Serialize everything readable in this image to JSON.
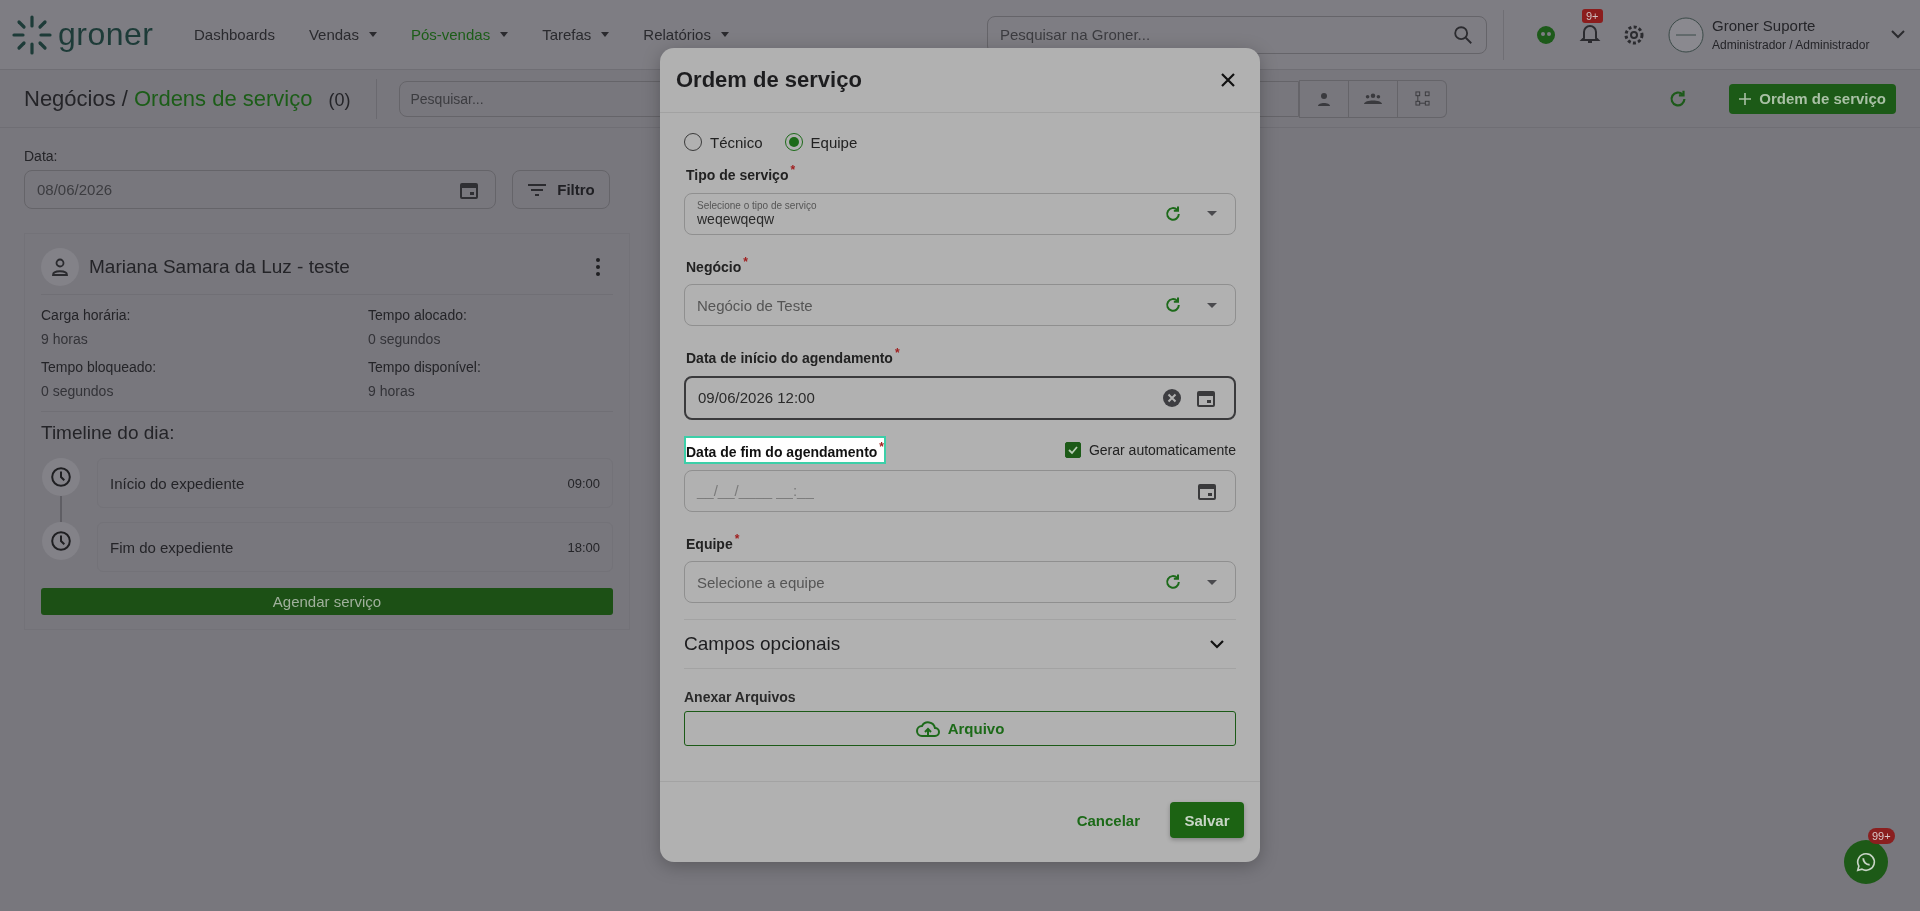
{
  "header": {
    "logo": "groner",
    "nav": [
      {
        "label": "Dashboards",
        "dropdown": false,
        "selected": false
      },
      {
        "label": "Vendas",
        "dropdown": true,
        "selected": false
      },
      {
        "label": "Pós-vendas",
        "dropdown": true,
        "selected": true
      },
      {
        "label": "Tarefas",
        "dropdown": true,
        "selected": false
      },
      {
        "label": "Relatórios",
        "dropdown": true,
        "selected": false
      }
    ],
    "search": {
      "placeholder": "Pesquisar na Groner..."
    },
    "notification_badge": "9+",
    "user": {
      "name": "Groner Suporte",
      "role": "Administrador / Administrador"
    }
  },
  "toolbar": {
    "breadcrumb": "Negócios /",
    "title": "Ordens de serviço",
    "count": "(0)",
    "search": {
      "placeholder": "Pesquisar..."
    },
    "new_button": "Ordem de serviço"
  },
  "filters": {
    "date_label": "Data:",
    "date_value": "08/06/2026",
    "filter_button": "Filtro"
  },
  "technician_card": {
    "name": "Mariana Samara da Luz - teste",
    "stats": [
      {
        "label": "Carga horária:",
        "value": "9 horas"
      },
      {
        "label": "Tempo alocado:",
        "value": "0 segundos"
      },
      {
        "label": "Tempo bloqueado:",
        "value": "0 segundos"
      },
      {
        "label": "Tempo disponível:",
        "value": "9 horas"
      }
    ],
    "timeline_title": "Timeline do dia:",
    "timeline": [
      {
        "label": "Início do expediente",
        "time": "09:00"
      },
      {
        "label": "Fim do expediente",
        "time": "18:00"
      }
    ],
    "schedule_button": "Agendar serviço"
  },
  "modal": {
    "title": "Ordem de serviço",
    "assign_to": [
      {
        "label": "Técnico",
        "selected": false
      },
      {
        "label": "Equipe",
        "selected": true
      }
    ],
    "fields": [
      {
        "kind": "select",
        "label": "Tipo de serviço",
        "required_mark": "*",
        "floating_label": "Selecione o tipo de serviço",
        "value": "weqewqeqw",
        "focused": false,
        "highlighted": false
      },
      {
        "kind": "select",
        "label": "Negócio",
        "required_mark": "*",
        "placeholder": "Negócio de Teste",
        "focused": false,
        "highlighted": false
      },
      {
        "kind": "datetime",
        "label": "Data de início do agendamento",
        "required_mark": "*",
        "value": "09/06/2026 12:00",
        "focused": true,
        "highlighted": false
      },
      {
        "kind": "datetime",
        "label": "Data de fim do agendamento",
        "required_mark": "*",
        "placeholder": "__/__/____ __:__",
        "auto": {
          "label": "Gerar automaticamente",
          "checked": true
        },
        "focused": false,
        "highlighted": true
      },
      {
        "kind": "select",
        "label": "Equipe",
        "required_mark": "*",
        "placeholder": "Selecione a equipe",
        "focused": false,
        "highlighted": false
      }
    ],
    "optional": {
      "title": "Campos opcionais",
      "expanded": false
    },
    "attachments": {
      "label": "Anexar Arquivos",
      "button": "Arquivo"
    },
    "cancel": "Cancelar",
    "save": "Salvar"
  },
  "chat_badge": "99+"
}
